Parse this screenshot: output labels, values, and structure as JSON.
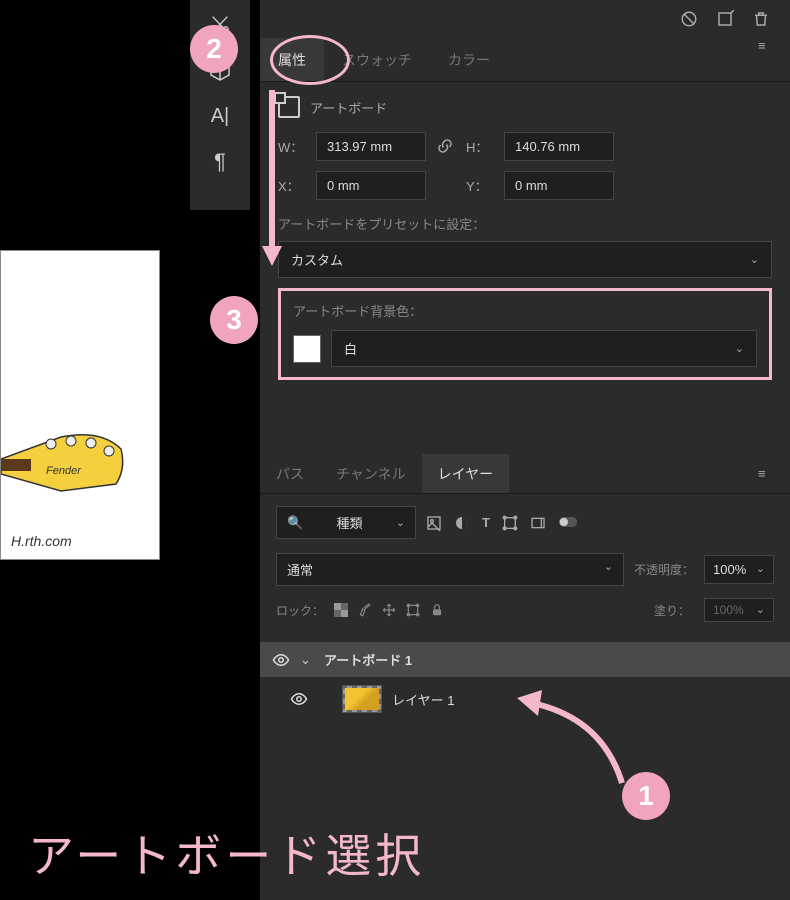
{
  "canvas": {
    "watermark": "H.rth.com"
  },
  "topIcons": [
    "no-entry-icon",
    "align-icon",
    "trash-icon"
  ],
  "tabs": {
    "t1": "属性",
    "t2": "スウォッチ",
    "t3": "カラー"
  },
  "artboard": {
    "label": "アートボード",
    "w_label": "W：",
    "w_value": "313.97 mm",
    "h_label": "H：",
    "h_value": "140.76 mm",
    "x_label": "X：",
    "x_value": "0 mm",
    "y_label": "Y：",
    "y_value": "0 mm",
    "preset_label": "アートボードをプリセットに設定：",
    "preset_value": "カスタム",
    "bg_label": "アートボード背景色：",
    "bg_value": "白"
  },
  "layersTabs": {
    "t1": "パス",
    "t2": "チャンネル",
    "t3": "レイヤー"
  },
  "layers": {
    "search_icon": "🔍",
    "search_value": "種類",
    "blend_value": "通常",
    "opacity_label": "不透明度：",
    "opacity_value": "100%",
    "lock_label": "ロック：",
    "fill_label": "塗り：",
    "fill_value": "100%",
    "item1": "アートボード 1",
    "item2": "レイヤー 1"
  },
  "annotations": {
    "b1": "1",
    "b2": "2",
    "b3": "3",
    "bottom": "アートボード選択"
  }
}
